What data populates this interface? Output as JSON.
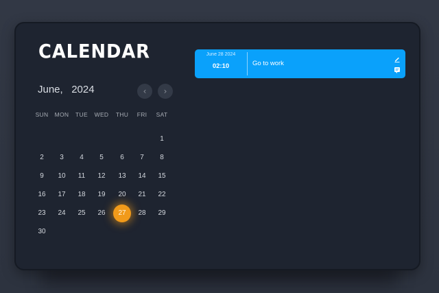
{
  "header": {
    "title": "CALENDAR"
  },
  "calendar": {
    "month": "June,",
    "year": "2024",
    "nav": {
      "prev_icon": "chevron-left-icon",
      "next_icon": "chevron-right-icon"
    },
    "weekdays": [
      "SUN",
      "MON",
      "TUE",
      "WED",
      "THU",
      "FRI",
      "SAT"
    ],
    "days": [
      "1",
      "2",
      "3",
      "4",
      "5",
      "6",
      "7",
      "8",
      "9",
      "10",
      "11",
      "12",
      "13",
      "14",
      "15",
      "16",
      "17",
      "18",
      "19",
      "20",
      "21",
      "22",
      "23",
      "24",
      "25",
      "26",
      "27",
      "28",
      "29",
      "30"
    ],
    "first_weekday_index": 6,
    "selected_day": "27",
    "selected_color": "#f19a1a"
  },
  "events": [
    {
      "date": "June 28 2024",
      "time": "02:10",
      "title": "Go to work",
      "color": "#0aa1fb",
      "actions": [
        "edit-icon",
        "note-icon"
      ]
    }
  ]
}
